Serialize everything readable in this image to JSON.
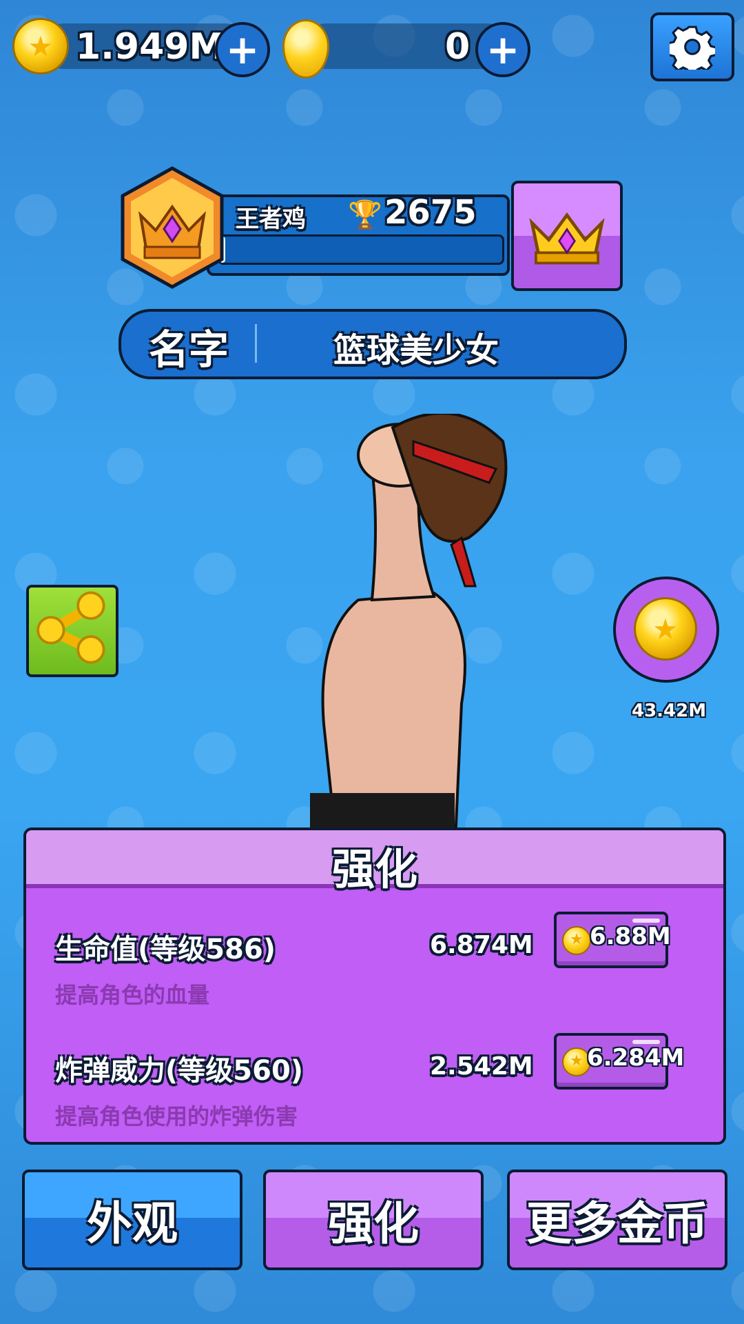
{
  "top_bar": {
    "gold_coins": "1.949M",
    "gems": "0"
  },
  "rank": {
    "title": "王者鸡",
    "trophies": "2675",
    "progress": 0.02
  },
  "profile": {
    "name_label": "名字",
    "name_value": "篮球美少女"
  },
  "side": {
    "coin_reward_value": "43.42M"
  },
  "upgrade_panel": {
    "title": "强化",
    "items": [
      {
        "name": "生命值(等级586)",
        "description": "提高角色的血量",
        "value": "6.874M",
        "cost": "6.88M"
      },
      {
        "name": "炸弹威力(等级560)",
        "description": "提高角色使用的炸弹伤害",
        "value": "2.542M",
        "cost": "6.284M"
      }
    ]
  },
  "tabs": {
    "appearance": "外观",
    "upgrade": "强化",
    "more_coins": "更多金币"
  },
  "icons": {
    "gold": "coin-icon",
    "gem": "gem-icon",
    "settings": "gear-icon",
    "trophy": "trophy-icon",
    "crown": "crown-icon",
    "share": "share-icon"
  },
  "colors": {
    "background": "#3aa2ee",
    "panel": "#c05ef5",
    "tab_blue": "#1f78dc",
    "tab_purple": "#b55de9",
    "outline": "#0b1b33"
  }
}
